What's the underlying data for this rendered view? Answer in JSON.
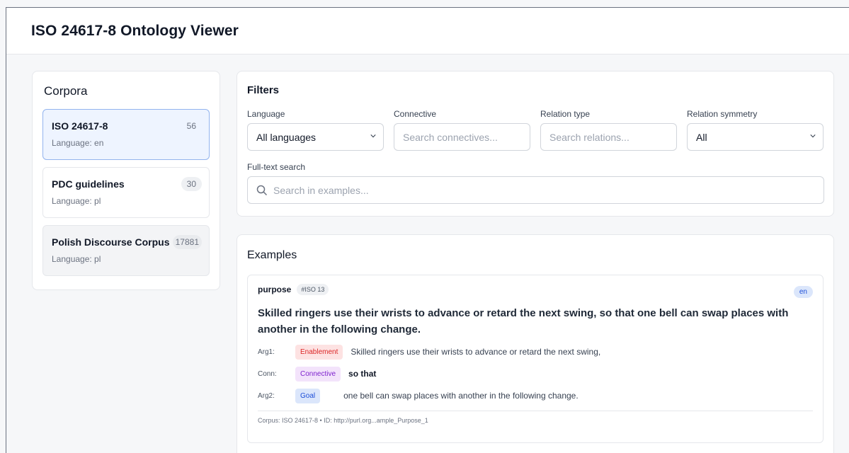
{
  "app": {
    "title": "ISO 24617-8 Ontology Viewer"
  },
  "sidebar": {
    "title": "Corpora",
    "items": [
      {
        "name": "ISO 24617-8",
        "language": "Language: en",
        "count": "56",
        "state": "selected"
      },
      {
        "name": "PDC guidelines",
        "language": "Language: pl",
        "count": "30",
        "state": "default"
      },
      {
        "name": "Polish Discourse Corpus",
        "language": "Language: pl",
        "count": "17881",
        "state": "default"
      }
    ]
  },
  "filters": {
    "title": "Filters",
    "language": {
      "label": "Language",
      "value": "All languages"
    },
    "connective": {
      "label": "Connective",
      "placeholder": "Search connectives..."
    },
    "relation_type": {
      "label": "Relation type",
      "placeholder": "Search relations..."
    },
    "symmetry": {
      "label": "Relation symmetry",
      "value": "All"
    },
    "fulltext": {
      "label": "Full-text search",
      "placeholder": "Search in examples..."
    }
  },
  "examples": {
    "title": "Examples",
    "items": [
      {
        "relation": "purpose",
        "tag": "#ISO 13",
        "lang": "en",
        "sentence": "Skilled ringers use their wrists to advance or retard the next swing, so that one bell can swap places with another in the following change.",
        "arg1": {
          "key": "Arg1:",
          "role": "Enablement",
          "text": "Skilled ringers use their wrists to advance or retard the next swing,"
        },
        "conn": {
          "key": "Conn:",
          "role": "Connective",
          "text": "so that"
        },
        "arg2": {
          "key": "Arg2:",
          "role": "Goal",
          "text": "one bell can swap places with another in the following change."
        },
        "footer": "Corpus: ISO 24617-8 • ID: http://purl.org...ample_Purpose_1"
      }
    ]
  },
  "colors": {
    "accent": "#2563eb",
    "selected_bg": "#eef4ff",
    "enablement": "#dc2626",
    "connective": "#7e22ce",
    "goal": "#1d4ed8"
  },
  "icons": [
    "chevron-down-icon",
    "search-icon"
  ]
}
